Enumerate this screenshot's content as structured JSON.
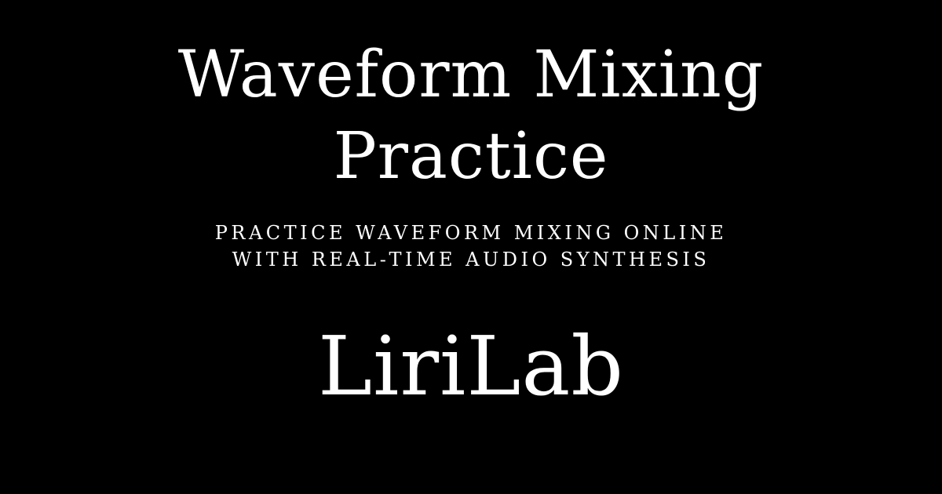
{
  "card": {
    "background_color": "#000000",
    "text_color": "#ffffff",
    "title_lines": [
      "Waveform Mixing",
      "Practice"
    ],
    "subtitle_lines": [
      "PRACTICE WAVEFORM MIXING ONLINE",
      "WITH REAL-TIME AUDIO SYNTHESIS"
    ],
    "brand": "LiriLab"
  }
}
